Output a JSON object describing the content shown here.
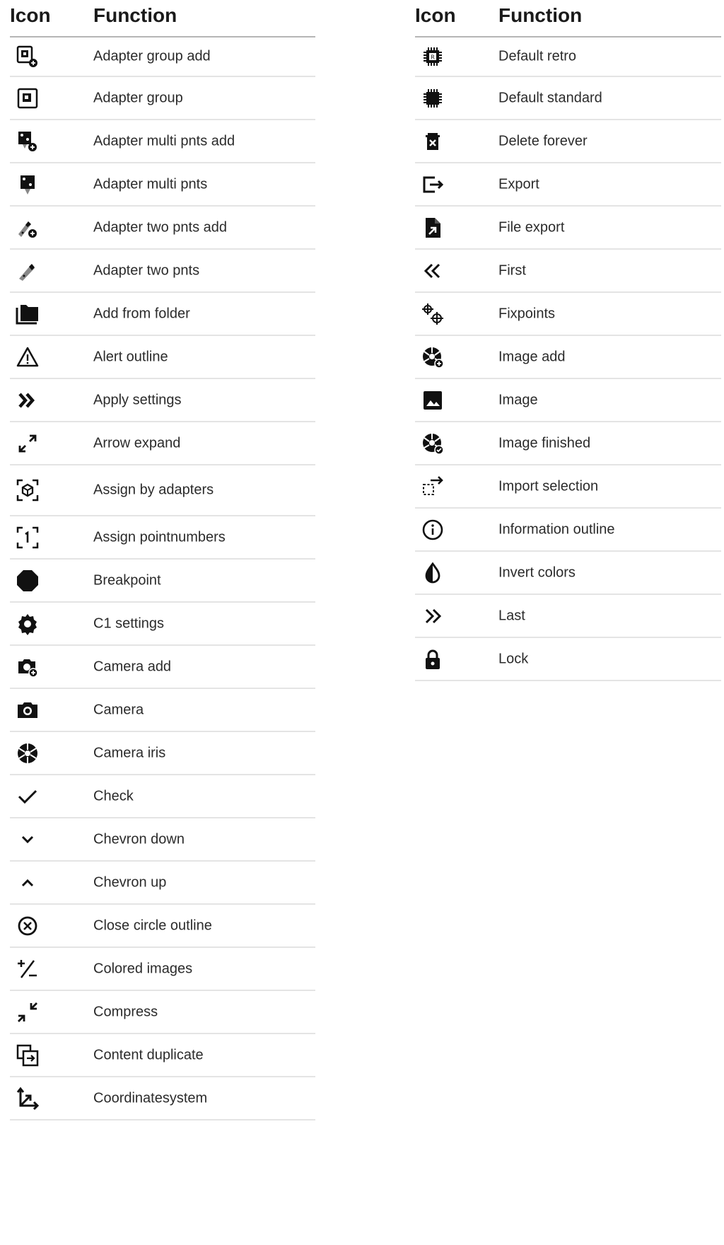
{
  "columns": {
    "icon": "Icon",
    "function": "Function"
  },
  "left_rows": [
    {
      "icon": "adapter-group-add-icon",
      "label": "Adapter group add"
    },
    {
      "icon": "adapter-group-icon",
      "label": "Adapter group"
    },
    {
      "icon": "adapter-multi-pnts-add-icon",
      "label": "Adapter multi pnts add"
    },
    {
      "icon": "adapter-multi-pnts-icon",
      "label": "Adapter multi pnts"
    },
    {
      "icon": "adapter-two-pnts-add-icon",
      "label": "Adapter two pnts add"
    },
    {
      "icon": "adapter-two-pnts-icon",
      "label": "Adapter two pnts"
    },
    {
      "icon": "folder-multiple-icon",
      "label": "Add from folder"
    },
    {
      "icon": "alert-outline-icon",
      "label": "Alert outline"
    },
    {
      "icon": "double-chevron-right-bold-icon",
      "label": "Apply settings"
    },
    {
      "icon": "arrow-expand-icon",
      "label": "Arrow expand"
    },
    {
      "icon": "cube-scan-icon",
      "label": "Assign by adapters"
    },
    {
      "icon": "numeric-one-scan-icon",
      "label": "Assign pointnumbers"
    },
    {
      "icon": "octagon-icon",
      "label": "Breakpoint"
    },
    {
      "icon": "gear-icon",
      "label": "C1 settings"
    },
    {
      "icon": "camera-add-icon",
      "label": "Camera add"
    },
    {
      "icon": "camera-icon",
      "label": "Camera"
    },
    {
      "icon": "camera-iris-icon",
      "label": "Camera iris"
    },
    {
      "icon": "check-icon",
      "label": "Check"
    },
    {
      "icon": "chevron-down-icon",
      "label": "Chevron down"
    },
    {
      "icon": "chevron-up-icon",
      "label": "Chevron up"
    },
    {
      "icon": "close-circle-outline-icon",
      "label": "Close circle outline"
    },
    {
      "icon": "plus-minus-icon",
      "label": "Colored images"
    },
    {
      "icon": "arrow-compress-icon",
      "label": "Compress"
    },
    {
      "icon": "content-duplicate-icon",
      "label": "Content duplicate"
    },
    {
      "icon": "axis-arrow-icon",
      "label": "Coordinatesystem"
    }
  ],
  "right_rows": [
    {
      "icon": "chip-r-icon",
      "label": "Default retro"
    },
    {
      "icon": "chip-icon",
      "label": "Default standard"
    },
    {
      "icon": "delete-forever-icon",
      "label": "Delete forever"
    },
    {
      "icon": "export-icon",
      "label": "Export"
    },
    {
      "icon": "file-export-icon",
      "label": "File export"
    },
    {
      "icon": "double-chevron-left-icon",
      "label": "First"
    },
    {
      "icon": "crosshairs-pair-icon",
      "label": "Fixpoints"
    },
    {
      "icon": "iris-plus-icon",
      "label": "Image add"
    },
    {
      "icon": "image-icon",
      "label": "Image"
    },
    {
      "icon": "iris-check-icon",
      "label": "Image finished"
    },
    {
      "icon": "selection-import-icon",
      "label": "Import selection"
    },
    {
      "icon": "information-outline-icon",
      "label": "Information outline"
    },
    {
      "icon": "invert-colors-icon",
      "label": "Invert colors"
    },
    {
      "icon": "double-chevron-right-icon",
      "label": "Last"
    },
    {
      "icon": "lock-icon",
      "label": "Lock"
    }
  ]
}
